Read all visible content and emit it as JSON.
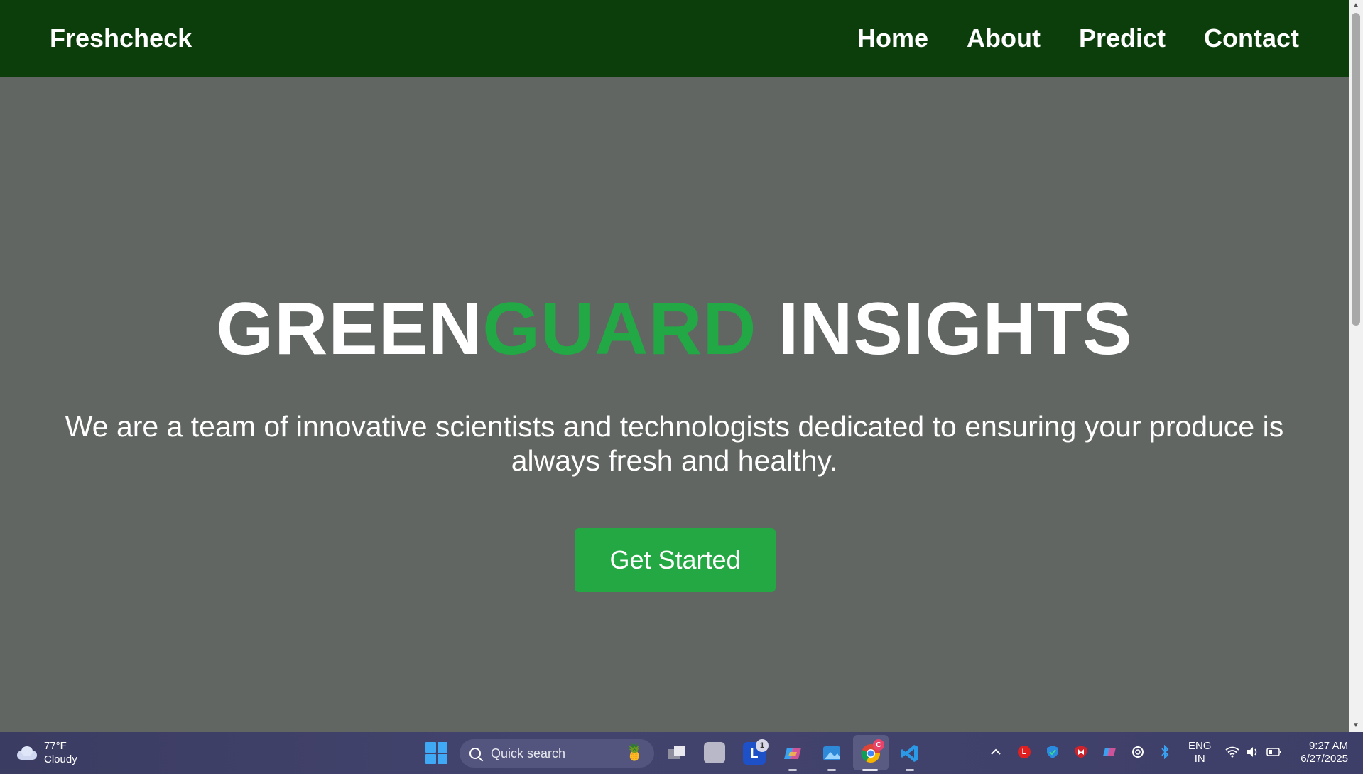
{
  "navbar": {
    "brand": "Freshcheck",
    "links": [
      "Home",
      "About",
      "Predict",
      "Contact"
    ]
  },
  "hero": {
    "title_part1": "GREEN",
    "title_accent": "GUARD",
    "title_part2": " INSIGHTS",
    "subtitle": "We are a team of innovative scientists and technologists dedicated to ensuring your produce is always fresh and healthy.",
    "cta_label": "Get Started"
  },
  "colors": {
    "navbar_bg": "#0b3e0b",
    "page_bg": "#616662",
    "accent_green": "#22a845"
  },
  "taskbar": {
    "weather_temp": "77°F",
    "weather_desc": "Cloudy",
    "search_placeholder": "Quick search",
    "lang_line1": "ENG",
    "lang_line2": "IN",
    "time": "9:27 AM",
    "date": "6/27/2025",
    "badge_count": "1",
    "chrome_badge": "C"
  }
}
